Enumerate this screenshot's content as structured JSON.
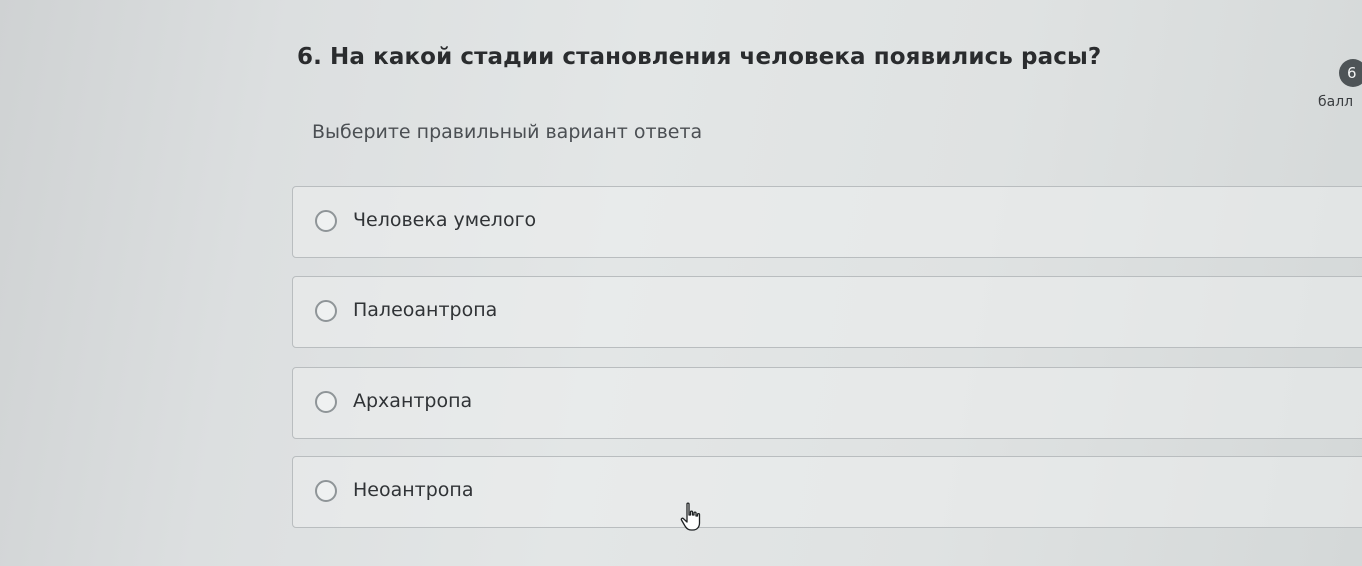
{
  "question": {
    "title": "6. На какой стадии становления человека появились расы?",
    "instruction": "Выберите правильный вариант ответа"
  },
  "points": {
    "value": "6",
    "label": "балл"
  },
  "options": [
    {
      "label": "Человека умелого"
    },
    {
      "label": "Палеоантропа"
    },
    {
      "label": "Архантропа"
    },
    {
      "label": "Неоантропа"
    }
  ],
  "icons": {
    "radio": "radio-circle-icon",
    "cursor": "hand-pointer-icon"
  }
}
